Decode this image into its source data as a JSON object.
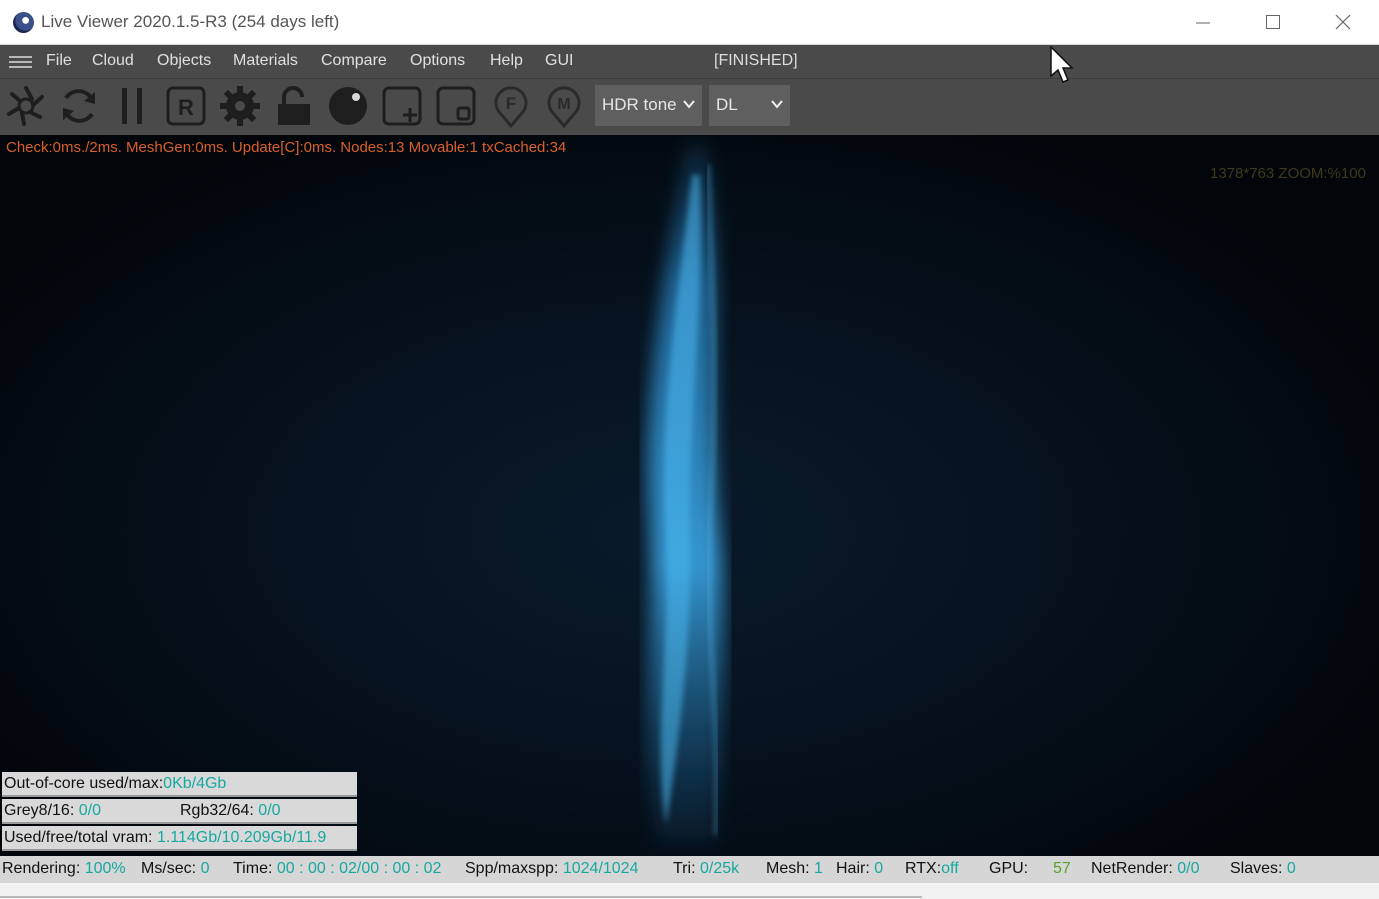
{
  "window": {
    "title": "Live Viewer 2020.1.5-R3 (254 days left)"
  },
  "menu": {
    "items": [
      "File",
      "Cloud",
      "Objects",
      "Materials",
      "Compare",
      "Options",
      "Help",
      "GUI"
    ],
    "status": "[FINISHED]"
  },
  "toolbar": {
    "tools": [
      "aperture-icon",
      "refresh-icon",
      "pause-icon",
      "render-region-icon",
      "settings-gear-icon",
      "unlock-icon",
      "material-sphere-icon",
      "add-frame-icon",
      "small-frame-icon",
      "focus-pin-icon",
      "material-pin-icon"
    ],
    "tonemap_dropdown": "HDR tone",
    "kernel_dropdown": "DL"
  },
  "viewport": {
    "stats": "Check:0ms./2ms. MeshGen:0ms. Update[C]:0ms. Nodes:13 Movable:1 txCached:34",
    "zoom": "1378*763 ZOOM:%100"
  },
  "info": {
    "ooc_label": "Out-of-core used/max:",
    "ooc_value": "0Kb/4Gb",
    "grey_label": "Grey8/16:",
    "grey_value": "0/0",
    "rgb_label": "Rgb32/64:",
    "rgb_value": "0/0",
    "vram_label": "Used/free/total vram:",
    "vram_value": "1.114Gb/10.209Gb/11.9"
  },
  "status": {
    "rendering_label": "Rendering:",
    "rendering_value": "100%",
    "mssec_label": "Ms/sec:",
    "mssec_value": "0",
    "time_label": "Time:",
    "time_value": "00 : 00 : 02/00 : 00 : 02",
    "spp_label": "Spp/maxspp:",
    "spp_value": "1024/1024",
    "tri_label": "Tri:",
    "tri_value": "0/25k",
    "mesh_label": "Mesh:",
    "mesh_value": "1",
    "hair_label": "Hair:",
    "hair_value": "0",
    "rtx_label": "RTX:",
    "rtx_value": "off",
    "gpu_label": "GPU:",
    "gpu_value": "57",
    "net_label": "NetRender:",
    "net_value": "0/0",
    "slaves_label": "Slaves:",
    "slaves_value": "0"
  },
  "colors": {
    "toolbar_bg": "#4a4a4a",
    "stats_text": "#d9602a",
    "value_cyan": "#16a9a0",
    "value_green": "#5aa02c"
  }
}
